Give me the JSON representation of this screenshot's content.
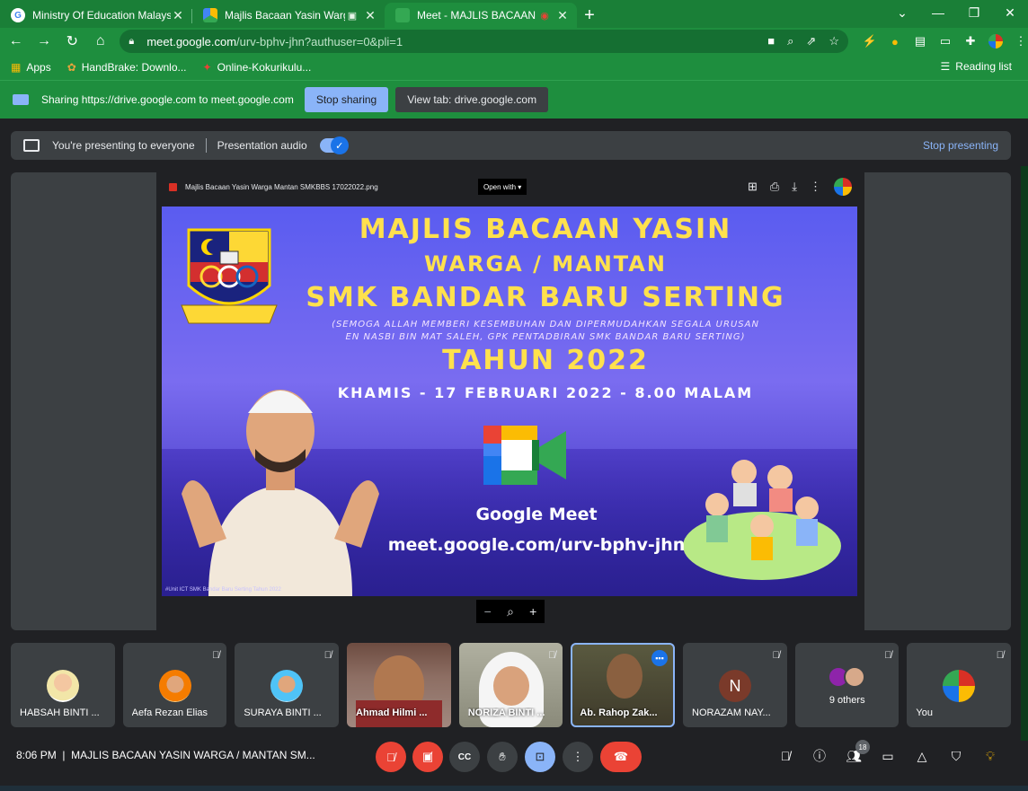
{
  "browser": {
    "tabs": [
      {
        "title": "Ministry Of Education Malaysia -",
        "active": false
      },
      {
        "title": "Majlis Bacaan Yasin Warga M",
        "active": false
      },
      {
        "title": "Meet - MAJLIS BACAAN YASI",
        "active": true
      }
    ],
    "address_host": "meet.google.com",
    "address_path": "/urv-bphv-jhn?authuser=0&pli=1",
    "bookmarks": [
      "Apps",
      "HandBrake: Downlo...",
      "Online-Kokurikulu..."
    ],
    "reading_list": "Reading list"
  },
  "sharebar": {
    "text": "Sharing https://drive.google.com to meet.google.com",
    "stop_sharing": "Stop sharing",
    "view_tab": "View tab: drive.google.com"
  },
  "presentbar": {
    "status": "You're presenting to everyone",
    "audio_label": "Presentation audio",
    "stop_presenting": "Stop presenting"
  },
  "viewer": {
    "filename": "Majlis Bacaan Yasin Warga Mantan SMKBBS 17022022.png",
    "open_with": "Open with"
  },
  "poster": {
    "line1": "MAJLIS BACAAN YASIN",
    "line2": "WARGA / MANTAN",
    "line3": "SMK BANDAR BARU SERTING",
    "line4": "(SEMOGA ALLAH MEMBERI KESEMBUHAN DAN DIPERMUDAHKAN SEGALA URUSAN",
    "line5": "EN NASBI BIN MAT SALEH, GPK PENTADBIRAN SMK BANDAR BARU SERTING)",
    "line6": "TAHUN 2022",
    "line7": "KHAMIS - 17 FEBRUARI 2022 - 8.00 MALAM",
    "meet_label": "Google Meet",
    "meet_link": "meet.google.com/urv-bphv-jhn",
    "credit": "#Unit ICT SMK Bandar Baru Serting Tahun 2022",
    "logo_motto": "ILMU USAHA JAYA"
  },
  "participants": [
    {
      "name": "HABSAH BINTI ...",
      "muted": false,
      "kind": "avatar"
    },
    {
      "name": "Aefa Rezan Elias",
      "muted": true,
      "kind": "avatar"
    },
    {
      "name": "SURAYA BINTI ...",
      "muted": true,
      "kind": "avatar"
    },
    {
      "name": "Ahmad Hilmi ...",
      "muted": false,
      "kind": "video"
    },
    {
      "name": "NORIZA BINTI ...",
      "muted": true,
      "kind": "video"
    },
    {
      "name": "Ab. Rahop Zak...",
      "muted": false,
      "kind": "video",
      "speaking": true
    },
    {
      "name": "NORAZAM NAY...",
      "muted": true,
      "kind": "letter",
      "letter": "N"
    },
    {
      "name": "9 others",
      "muted": true,
      "kind": "others"
    },
    {
      "name": "You",
      "muted": true,
      "kind": "avatar"
    }
  ],
  "controls": {
    "time": "8:06 PM",
    "meeting_title": "MAJLIS BACAAN YASIN WARGA / MANTAN SM...",
    "people_count": "18"
  }
}
